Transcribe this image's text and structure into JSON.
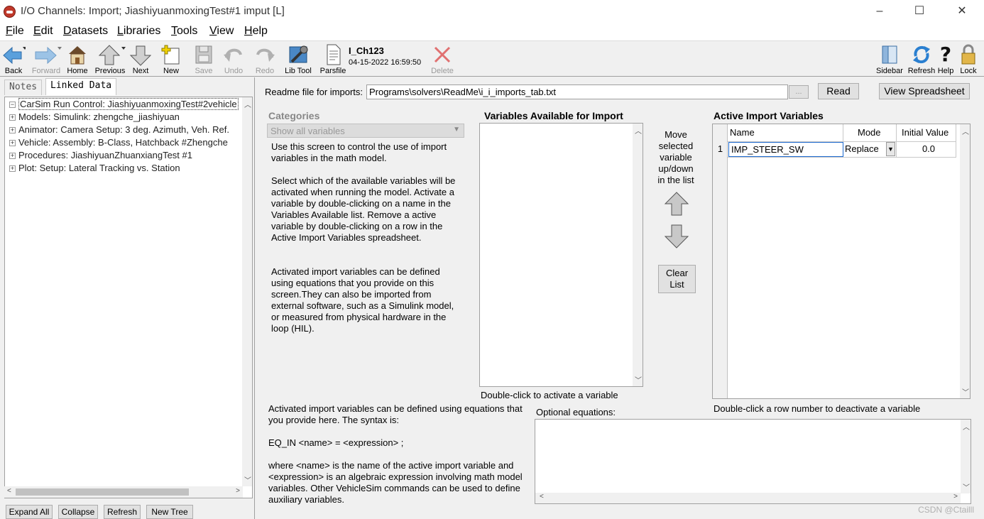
{
  "window": {
    "title": "I/O Channels: Import;  JiashiyuanmoxingTest#1 imput [L]",
    "minimize": "–",
    "maximize": "☐",
    "close": "✕"
  },
  "menu": [
    {
      "label": "File",
      "accel": "F",
      "rest": "ile"
    },
    {
      "label": "Edit",
      "accel": "E",
      "rest": "dit"
    },
    {
      "label": "Datasets",
      "accel": "D",
      "rest": "atasets"
    },
    {
      "label": "Libraries",
      "accel": "L",
      "rest": "ibraries"
    },
    {
      "label": "Tools",
      "accel": "T",
      "rest": "ools"
    },
    {
      "label": "View",
      "accel": "V",
      "rest": "iew"
    },
    {
      "label": "Help",
      "accel": "H",
      "rest": "elp"
    }
  ],
  "toolbar": {
    "back": "Back",
    "forward": "Forward",
    "home": "Home",
    "previous": "Previous",
    "next": "Next",
    "new": "New",
    "save": "Save",
    "undo": "Undo",
    "redo": "Redo",
    "lib_tool": "Lib Tool",
    "parsfile": "Parsfile",
    "parsfile_name": "I_Ch123",
    "parsfile_date": "04-15-2022 16:59:50",
    "delete": "Delete",
    "sidebar": "Sidebar",
    "refresh": "Refresh",
    "help": "Help",
    "lock": "Lock"
  },
  "left": {
    "tabs": [
      "Notes",
      "Linked Data"
    ],
    "tree": [
      {
        "label": "CarSim Run Control: JiashiyuanmoxingTest#2vehicle",
        "expander": "−",
        "root": true
      },
      {
        "label": "Models: Simulink: zhengche_jiashiyuan",
        "expander": "+"
      },
      {
        "label": "Animator: Camera Setup: 3 deg. Azimuth, Veh. Ref.",
        "expander": "+"
      },
      {
        "label": "Vehicle: Assembly: B-Class, Hatchback #Zhengche",
        "expander": "+"
      },
      {
        "label": "Procedures: JiashiyuanZhuanxiangTest #1",
        "expander": "+"
      },
      {
        "label": "Plot: Setup: Lateral Tracking vs. Station",
        "expander": "+"
      }
    ],
    "buttons": {
      "expand_all": "Expand All",
      "collapse": "Collapse",
      "refresh": "Refresh",
      "new_tree": "New Tree"
    }
  },
  "main": {
    "readme_label": "Readme file for imports:",
    "readme_path": "Programs\\solvers\\ReadMe\\i_i_imports_tab.txt",
    "browse_btn": "...",
    "read_btn": "Read",
    "view_spreadsheet_btn": "View Spreadsheet",
    "categories_label": "Categories",
    "categories_value": "Show all variables",
    "help_text_1": "Use this screen to control the use of import variables in the math model.",
    "help_text_2": "Select which of the available variables will be activated when running the model. Activate a variable by double-clicking on a name in the Variables Available list. Remove a active variable by double-clicking on a row in the Active Import Variables spreadsheet.",
    "help_text_3": "Activated import variables can be defined using equations that you provide on this screen.They can also be imported from external software, such as a Simulink model, or measured from physical hardware in the loop (HIL).",
    "available_title": "Variables Available for Import",
    "available_hint": "Double-click to activate a variable",
    "move_text": "Move selected variable up/down in the list",
    "clear_list_btn": "Clear List",
    "active_title": "Active Import Variables",
    "active_columns": [
      "Name",
      "Mode",
      "Initial Value"
    ],
    "active_rows": [
      {
        "num": "1",
        "name": "IMP_STEER_SW",
        "mode": "Replace",
        "initial": "0.0"
      }
    ],
    "active_hint": "Double-click a row number to deactivate a variable",
    "eq_help_1": "Activated import variables can be defined using equations that you provide here. The syntax is:",
    "eq_help_2": "EQ_IN <name> = <expression> ;",
    "eq_help_3": "where <name> is the name of the active import variable and <expression> is an algebraic expression involving math model variables. Other VehicleSim commands can be used to define auxiliary variables.",
    "optional_label": "Optional equations:"
  },
  "watermark": "CSDN @Ctailll"
}
